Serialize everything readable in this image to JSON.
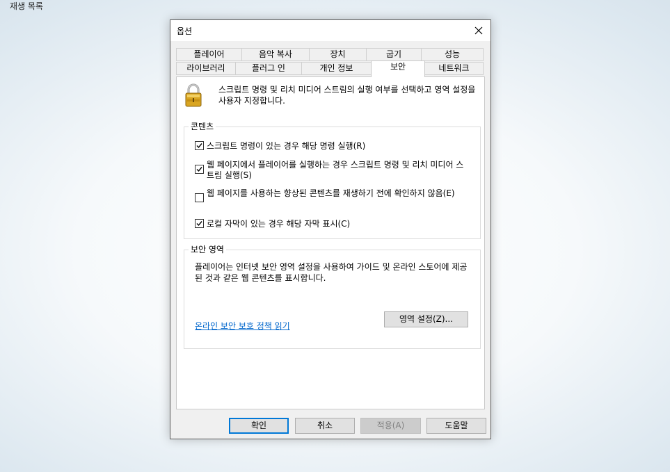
{
  "background_window": {
    "title": "재생 목록"
  },
  "dialog": {
    "title": "옵션",
    "close_label": "×",
    "tabs_row1": [
      "플레이어",
      "음악 복사",
      "장치",
      "굽기",
      "성능"
    ],
    "tabs_row2": [
      "라이브러리",
      "플러그 인",
      "개인 정보",
      "보안",
      "네트워크"
    ],
    "active_tab": "보안",
    "description": "스크립트 명령 및 리치 미디어 스트림의 실행 여부를 선택하고 영역 설정을 사용자 지정합니다.",
    "content_group": {
      "label": "콘텐츠",
      "options": [
        {
          "label": "스크립트 명령이 있는 경우 해당 명령 실행(R)",
          "checked": true
        },
        {
          "label": "웹 페이지에서 플레이어를 실행하는 경우 스크립트 명령 및 리치 미디어 스트림 실행(S)",
          "checked": true
        },
        {
          "label": "웹 페이지를 사용하는 향상된 콘텐츠를 재생하기 전에 확인하지 않음(E)",
          "checked": false
        },
        {
          "label": "로컬 자막이 있는 경우 해당 자막 표시(C)",
          "checked": true
        }
      ]
    },
    "zone_group": {
      "label": "보안 영역",
      "text": "플레이어는 인터넷 보안 영역 설정을 사용하여 가이드 및 온라인 스토어에 제공된 것과 같은 웹 콘텐츠를 표시합니다.",
      "link": "온라인 보안 보호 정책 읽기",
      "zone_button": "영역 설정(Z)..."
    },
    "buttons": {
      "ok": "확인",
      "cancel": "취소",
      "apply": "적용(A)",
      "help": "도움말"
    }
  }
}
